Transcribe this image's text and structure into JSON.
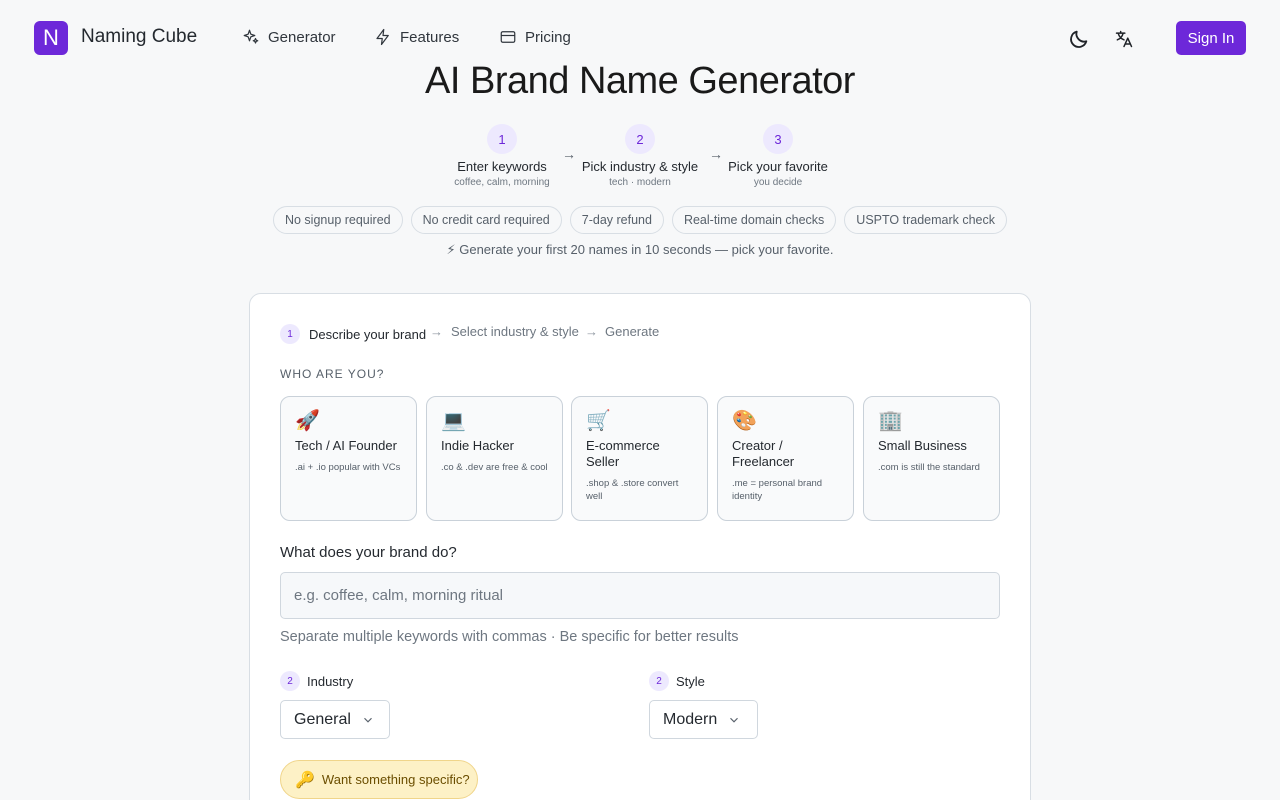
{
  "header": {
    "logo_letter": "N",
    "brand": "Naming Cube",
    "nav": [
      {
        "label": "Generator",
        "icon": "sparkle-icon"
      },
      {
        "label": "Features",
        "icon": "lightning-icon"
      },
      {
        "label": "Pricing",
        "icon": "credit-card-icon"
      }
    ],
    "theme_icon": "moon-icon",
    "language_icon": "translate-icon",
    "sign_in": "Sign In",
    "accent": "#6d28d9"
  },
  "title": "AI Brand Name Generator",
  "steps": [
    {
      "num": "1",
      "label": "Enter keywords",
      "sub": "coffee, calm, morning"
    },
    {
      "num": "2",
      "label": "Pick industry & style",
      "sub": "tech · modern"
    },
    {
      "num": "3",
      "label": "Pick your favorite",
      "sub": "you decide"
    }
  ],
  "step_arrow": "→",
  "pills": [
    "No signup required",
    "No credit card required",
    "7-day refund",
    "Real-time domain checks",
    "USPTO trademark check"
  ],
  "tagline": "⚡ Generate your first 20 names in 10 seconds — pick your favorite.",
  "form": {
    "steps": [
      {
        "num": "1",
        "label": "Describe your brand"
      },
      {
        "label": "Select industry & style"
      },
      {
        "label": "Generate"
      }
    ],
    "arrow": "→",
    "who_label": "WHO ARE YOU?",
    "personas": [
      {
        "emoji": "🚀",
        "title": "Tech / AI Founder",
        "desc": ".ai + .io popular with VCs"
      },
      {
        "emoji": "💻",
        "title": "Indie Hacker",
        "desc": ".co & .dev are free & cool"
      },
      {
        "emoji": "🛒",
        "title": "E-commerce Seller",
        "desc": ".shop & .store convert well"
      },
      {
        "emoji": "🎨",
        "title": "Creator / Freelancer",
        "desc": ".me = personal brand identity"
      },
      {
        "emoji": "🏢",
        "title": "Small Business",
        "desc": ".com is still the standard"
      }
    ],
    "question": "What does your brand do?",
    "keywords_placeholder": "e.g. coffee, calm, morning ritual",
    "keywords_value": "",
    "hint": "Separate multiple keywords with commas · Be specific for better results",
    "industry": {
      "num": "2",
      "label": "Industry",
      "value": "General"
    },
    "style": {
      "num": "2",
      "label": "Style",
      "value": "Modern"
    },
    "specific": {
      "emoji": "🔑",
      "label": "Want something specific?"
    }
  }
}
